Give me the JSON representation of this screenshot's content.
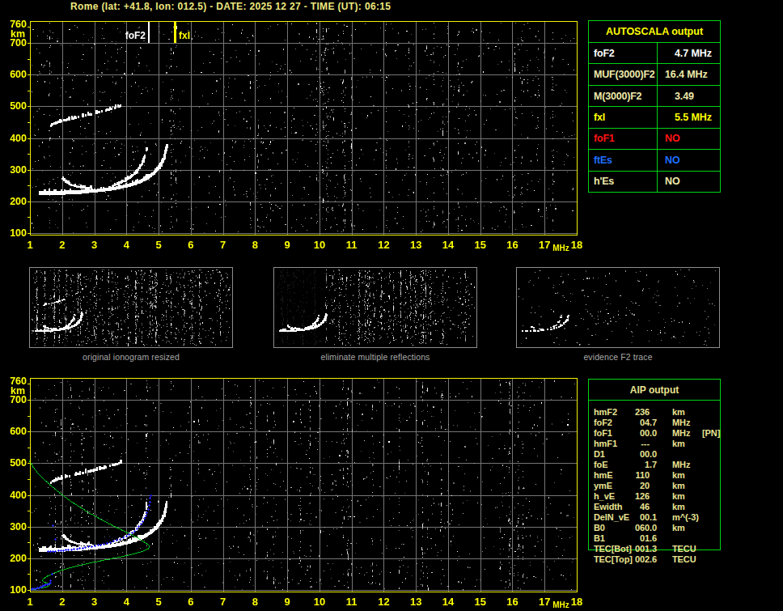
{
  "header": {
    "title": "Rome (lat: +41.8, lon: 012.5) - DATE: 2025 12 27 - TIME (UT): 06:15"
  },
  "colors": {
    "background": "#000000",
    "axis_border": "#f2f200",
    "axis_labels": "#ffff00",
    "grid": "#757575",
    "trace_white": "#ffffff",
    "table_border": "#00d414",
    "yellow": "#ffff00",
    "khaki": "#eee8aa",
    "white": "#ffffff",
    "red": "#ff1414",
    "blue": "#1f6fff",
    "aip_text": "#e9e390",
    "caption_gray": "#a8a8a8",
    "profile_green": "#00c41e",
    "points_blue": "#2525ff",
    "marker_foF2": "#ffffff",
    "marker_fxI": "#ffff00"
  },
  "autoscala": {
    "title": "AUTOSCALA output",
    "rows": [
      {
        "label": "foF2",
        "value": "4.7 MHz",
        "style": "color:#ffffff"
      },
      {
        "label": "MUF(3000)F2",
        "value": "16.4 MHz",
        "style": "color:#eee8aa"
      },
      {
        "label": "M(3000)F2",
        "value": "3.49",
        "style": "color:#eee8aa"
      },
      {
        "label": "fxI",
        "value": "5.5 MHz",
        "style": "color:#ffff00"
      },
      {
        "label": "foF1",
        "value": "NO",
        "style": "color:#ff1414"
      },
      {
        "label": "ftEs",
        "value": "NO",
        "style": "color:#1f6fff"
      },
      {
        "label": "h'Es",
        "value": "NO",
        "style": "color:#eee8aa"
      }
    ]
  },
  "aip": {
    "title": "AIP output",
    "rows": [
      {
        "label": "hmF2",
        "value": "236",
        "unit": "km",
        "extra": ""
      },
      {
        "label": "foF2",
        "value": "04.7",
        "unit": "MHz",
        "extra": ""
      },
      {
        "label": "foF1",
        "value": "00.0",
        "unit": "MHz",
        "extra": "[PN]"
      },
      {
        "label": "hmF1",
        "value": "---",
        "unit": "km",
        "extra": ""
      },
      {
        "label": "D1",
        "value": "00.0",
        "unit": "",
        "extra": ""
      },
      {
        "label": "foE",
        "value": "1.7",
        "unit": "MHz",
        "extra": ""
      },
      {
        "label": "hmE",
        "value": "110",
        "unit": "km",
        "extra": ""
      },
      {
        "label": "ymE",
        "value": "20",
        "unit": "km",
        "extra": ""
      },
      {
        "label": "h_vE",
        "value": "126",
        "unit": "km",
        "extra": ""
      },
      {
        "label": "Ewidth",
        "value": "46",
        "unit": "km",
        "extra": ""
      },
      {
        "label": "DelN_vE",
        "value": "00.1",
        "unit": "m^(-3)",
        "extra": ""
      },
      {
        "label": "B0",
        "value": "060.0",
        "unit": "km",
        "extra": ""
      },
      {
        "label": "B1",
        "value": "01.6",
        "unit": "",
        "extra": ""
      },
      {
        "label": "TEC[Bot]",
        "value": "001.3",
        "unit": "TECU",
        "extra": ""
      },
      {
        "label": "TEC[Top]",
        "value": "002.6",
        "unit": "TECU",
        "extra": ""
      }
    ]
  },
  "thumbnails": [
    {
      "caption": "original ionogram resized",
      "traces": "all",
      "noise": {
        "seed": 31,
        "speckles": 620,
        "streaks": 42
      }
    },
    {
      "caption": "eliminate multiple reflections",
      "traces": "no-multiples",
      "noise": {
        "seed": 47,
        "speckles": 560,
        "streaks": 40
      }
    },
    {
      "caption": "evidence F2 trace",
      "traces": "f2-only",
      "noise": {
        "seed": 59,
        "speckles": 215,
        "streaks": 0
      }
    }
  ],
  "chart_data": [
    {
      "type": "scatter",
      "xlabel": "MHz",
      "ylabel": "km",
      "xlim": [
        1,
        18
      ],
      "ylim": [
        95,
        769
      ],
      "xticks": [
        1,
        2,
        3,
        4,
        5,
        6,
        7,
        8,
        9,
        10,
        11,
        12,
        13,
        14,
        15,
        16,
        17,
        18
      ],
      "yticks": [
        100,
        200,
        300,
        400,
        500,
        600,
        700,
        760
      ],
      "grid": true,
      "legend": false,
      "markers": [
        {
          "label": "foF2",
          "x": 4.7,
          "color": "#ffffff",
          "side": "left"
        },
        {
          "label": "fxI",
          "x": 5.5,
          "color": "#ffff00",
          "side": "right"
        }
      ],
      "traces": [
        {
          "name": "F-trace flat (o+x overlap)",
          "w": 5,
          "pts": [
            [
              1.28,
              224
            ],
            [
              1.6,
              225
            ],
            [
              2.0,
              226
            ],
            [
              2.4,
              228
            ],
            [
              2.75,
              230
            ]
          ]
        },
        {
          "name": "F-trace rising band",
          "w": 4,
          "pts": [
            [
              2.75,
              230
            ],
            [
              3.1,
              233
            ],
            [
              3.45,
              237
            ],
            [
              3.75,
              242
            ],
            [
              4.0,
              248
            ],
            [
              4.2,
              254
            ]
          ]
        },
        {
          "name": "o-mode cusp",
          "w": 2,
          "pts": [
            [
              3.55,
              247
            ],
            [
              3.75,
              255
            ],
            [
              3.95,
              264
            ],
            [
              4.12,
              275
            ],
            [
              4.27,
              288
            ],
            [
              4.38,
              302
            ],
            [
              4.47,
              317
            ],
            [
              4.53,
              331
            ],
            [
              4.57,
              343
            ]
          ]
        },
        {
          "name": "o-mode asymptote dash",
          "w": 2,
          "broken": true,
          "pts": [
            [
              4.6,
              355
            ],
            [
              4.61,
              374
            ]
          ]
        },
        {
          "name": "x-mode cusp",
          "w": 3.5,
          "pts": [
            [
              4.2,
              254
            ],
            [
              4.45,
              263
            ],
            [
              4.65,
              274
            ],
            [
              4.83,
              287
            ],
            [
              4.98,
              302
            ],
            [
              5.08,
              318
            ],
            [
              5.15,
              334
            ],
            [
              5.19,
              350
            ],
            [
              5.22,
              363
            ],
            [
              5.23,
              374
            ]
          ]
        },
        {
          "name": "x-mode hook",
          "w": 2,
          "pts": [
            [
              2.0,
              271
            ],
            [
              2.1,
              260
            ],
            [
              2.25,
              251
            ],
            [
              2.45,
              245
            ],
            [
              2.65,
              242
            ],
            [
              2.9,
              241
            ]
          ]
        },
        {
          "name": "second-hop reflection",
          "w": 2.8,
          "broken": true,
          "pts": [
            [
              1.63,
              438
            ],
            [
              1.78,
              446
            ],
            [
              1.98,
              452
            ],
            [
              2.22,
              458
            ],
            [
              2.5,
              465
            ],
            [
              2.8,
              472
            ],
            [
              3.08,
              479
            ],
            [
              3.34,
              486
            ],
            [
              3.56,
              492
            ],
            [
              3.72,
              498
            ],
            [
              3.8,
              502
            ]
          ]
        }
      ],
      "noise": {
        "seed": 7,
        "speckles": 1250,
        "streaks": 32
      }
    },
    {
      "type": "scatter",
      "xlabel": "MHz",
      "ylabel": "km",
      "xlim": [
        1,
        18
      ],
      "ylim": [
        95,
        769
      ],
      "xticks": [
        1,
        2,
        3,
        4,
        5,
        6,
        7,
        8,
        9,
        10,
        11,
        12,
        13,
        14,
        15,
        16,
        17,
        18
      ],
      "yticks": [
        100,
        200,
        300,
        400,
        500,
        600,
        700,
        760
      ],
      "grid": true,
      "legend": false,
      "markers": [],
      "traces": [
        {
          "name": "F-trace flat (o+x overlap)",
          "w": 5,
          "pts": [
            [
              1.28,
              224
            ],
            [
              1.6,
              225
            ],
            [
              2.0,
              226
            ],
            [
              2.4,
              228
            ],
            [
              2.75,
              230
            ]
          ]
        },
        {
          "name": "F-trace rising band",
          "w": 4,
          "pts": [
            [
              2.75,
              230
            ],
            [
              3.1,
              233
            ],
            [
              3.45,
              237
            ],
            [
              3.75,
              242
            ],
            [
              4.0,
              248
            ],
            [
              4.2,
              254
            ]
          ]
        },
        {
          "name": "o-mode cusp",
          "w": 2,
          "pts": [
            [
              3.55,
              247
            ],
            [
              3.75,
              255
            ],
            [
              3.95,
              264
            ],
            [
              4.12,
              275
            ],
            [
              4.27,
              288
            ],
            [
              4.38,
              302
            ],
            [
              4.47,
              317
            ],
            [
              4.53,
              331
            ],
            [
              4.57,
              343
            ]
          ]
        },
        {
          "name": "o-mode asymptote dash",
          "w": 2,
          "broken": true,
          "pts": [
            [
              4.6,
              355
            ],
            [
              4.61,
              374
            ]
          ]
        },
        {
          "name": "x-mode cusp",
          "w": 3.5,
          "pts": [
            [
              4.2,
              254
            ],
            [
              4.45,
              263
            ],
            [
              4.65,
              274
            ],
            [
              4.83,
              287
            ],
            [
              4.98,
              302
            ],
            [
              5.08,
              318
            ],
            [
              5.15,
              334
            ],
            [
              5.19,
              350
            ],
            [
              5.22,
              363
            ],
            [
              5.23,
              374
            ]
          ]
        },
        {
          "name": "x-mode hook",
          "w": 2,
          "pts": [
            [
              2.0,
              271
            ],
            [
              2.1,
              260
            ],
            [
              2.25,
              251
            ],
            [
              2.45,
              245
            ],
            [
              2.65,
              242
            ],
            [
              2.9,
              241
            ]
          ]
        },
        {
          "name": "second-hop reflection",
          "w": 2.8,
          "broken": true,
          "pts": [
            [
              1.63,
              438
            ],
            [
              1.78,
              446
            ],
            [
              1.98,
              452
            ],
            [
              2.22,
              458
            ],
            [
              2.5,
              465
            ],
            [
              2.8,
              472
            ],
            [
              3.08,
              479
            ],
            [
              3.34,
              486
            ],
            [
              3.56,
              492
            ],
            [
              3.72,
              498
            ],
            [
              3.8,
              502
            ]
          ]
        }
      ],
      "profile": [
        [
          0.98,
          508
        ],
        [
          1.1,
          488
        ],
        [
          1.25,
          468
        ],
        [
          1.45,
          448
        ],
        [
          1.7,
          425
        ],
        [
          2.0,
          400
        ],
        [
          2.3,
          378
        ],
        [
          2.6,
          358
        ],
        [
          2.9,
          340
        ],
        [
          3.2,
          323
        ],
        [
          3.5,
          307
        ],
        [
          3.8,
          292
        ],
        [
          4.1,
          277
        ],
        [
          4.35,
          264
        ],
        [
          4.55,
          252
        ],
        [
          4.68,
          243
        ],
        [
          4.72,
          237
        ],
        [
          4.68,
          230
        ],
        [
          4.5,
          222
        ],
        [
          4.2,
          213
        ],
        [
          3.8,
          204
        ],
        [
          3.4,
          196
        ],
        [
          3.0,
          188
        ],
        [
          2.6,
          179
        ],
        [
          2.25,
          170
        ],
        [
          1.95,
          161
        ],
        [
          1.72,
          152
        ],
        [
          1.55,
          144
        ],
        [
          1.44,
          137
        ],
        [
          1.38,
          131
        ],
        [
          1.42,
          126
        ],
        [
          1.52,
          122
        ],
        [
          1.6,
          119
        ],
        [
          1.62,
          116
        ],
        [
          1.55,
          111
        ],
        [
          1.4,
          107
        ],
        [
          1.2,
          103
        ],
        [
          1.05,
          101
        ],
        [
          0.98,
          100
        ]
      ],
      "scaled_points": [
        [
          1.02,
          103
        ],
        [
          1.07,
          104
        ],
        [
          1.12,
          105
        ],
        [
          1.17,
          106
        ],
        [
          1.22,
          107
        ],
        [
          1.27,
          109
        ],
        [
          1.32,
          111
        ],
        [
          1.37,
          113
        ],
        [
          1.42,
          115
        ],
        [
          1.47,
          117
        ],
        [
          1.52,
          119
        ],
        [
          1.57,
          121
        ],
        [
          1.62,
          124
        ],
        [
          1.64,
          131
        ],
        [
          1.67,
          152
        ],
        [
          1.7,
          304
        ],
        [
          1.78,
          261
        ],
        [
          1.55,
          222
        ],
        [
          1.63,
          222
        ],
        [
          1.71,
          223
        ],
        [
          1.79,
          223
        ],
        [
          1.87,
          224
        ],
        [
          1.95,
          225
        ],
        [
          2.03,
          226
        ],
        [
          2.11,
          227
        ],
        [
          2.19,
          228
        ],
        [
          2.27,
          229
        ],
        [
          2.36,
          230
        ],
        [
          2.45,
          231
        ],
        [
          2.54,
          232
        ],
        [
          2.63,
          234
        ],
        [
          2.72,
          235
        ],
        [
          2.81,
          237
        ],
        [
          2.9,
          238
        ],
        [
          3.0,
          240
        ],
        [
          3.1,
          242
        ],
        [
          3.2,
          244
        ],
        [
          3.3,
          246
        ],
        [
          3.4,
          249
        ],
        [
          3.5,
          252
        ],
        [
          3.6,
          255
        ],
        [
          3.7,
          258
        ],
        [
          3.8,
          262
        ],
        [
          3.9,
          266
        ],
        [
          4.0,
          271
        ],
        [
          4.08,
          276
        ],
        [
          4.16,
          281
        ],
        [
          4.24,
          287
        ],
        [
          4.31,
          294
        ],
        [
          4.38,
          301
        ],
        [
          4.44,
          309
        ],
        [
          4.5,
          318
        ],
        [
          4.55,
          327
        ],
        [
          4.59,
          336
        ],
        [
          4.63,
          346
        ],
        [
          4.66,
          356
        ],
        [
          4.69,
          367
        ],
        [
          4.71,
          378
        ],
        [
          4.73,
          390
        ],
        [
          4.74,
          400
        ]
      ],
      "noise": {
        "seed": 13,
        "speckles": 1150,
        "streaks": 32
      }
    }
  ]
}
